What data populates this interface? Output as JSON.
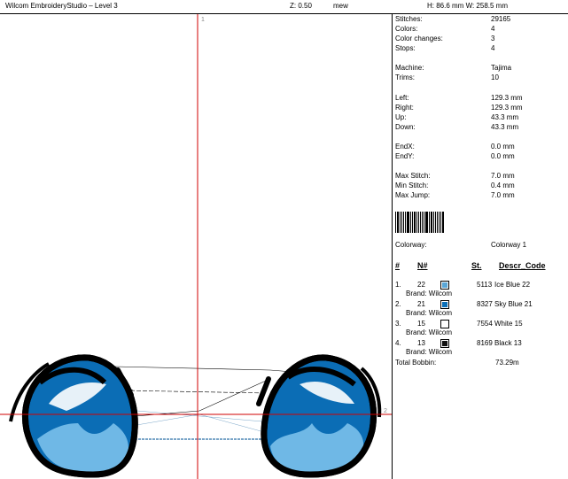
{
  "header": {
    "app_title": "Wilcom EmbroideryStudio – Level 3",
    "zoom": "Z: 0.50",
    "design_name": "mew",
    "dimensions": "H: 86.6 mm  W: 258.5 mm"
  },
  "canvas": {
    "marker_top": "1",
    "marker_right": "2"
  },
  "stats": [
    {
      "key": "Stitches:",
      "value": "29165"
    },
    {
      "key": "Colors:",
      "value": "4"
    },
    {
      "key": "Color changes:",
      "value": "3"
    },
    {
      "key": "Stops:",
      "value": "4"
    },
    {
      "key": "Machine:",
      "value": "Tajima"
    },
    {
      "key": "Trims:",
      "value": "10"
    },
    {
      "key": "Left:",
      "value": "129.3 mm"
    },
    {
      "key": "Right:",
      "value": "129.3 mm"
    },
    {
      "key": "Up:",
      "value": "43.3 mm"
    },
    {
      "key": "Down:",
      "value": "43.3 mm"
    },
    {
      "key": "EndX:",
      "value": "0.0 mm"
    },
    {
      "key": "EndY:",
      "value": "0.0 mm"
    },
    {
      "key": "Max Stitch:",
      "value": "7.0 mm"
    },
    {
      "key": "Min Stitch:",
      "value": "0.4 mm"
    },
    {
      "key": "Max Jump:",
      "value": "7.0 mm"
    }
  ],
  "colorway": {
    "key": "Colorway:",
    "value": "Colorway 1"
  },
  "columns": {
    "num": "#",
    "n": "N#",
    "st": "St.",
    "descr": "Descr_Code"
  },
  "threads": [
    {
      "index": "1.",
      "n": "22",
      "color": "#5aa6d6",
      "st": "5113",
      "descr": "Ice Blue 22",
      "brand": "Brand: Wilcom"
    },
    {
      "index": "2.",
      "n": "21",
      "color": "#0a6fb8",
      "st": "8327",
      "descr": "Sky Blue 21",
      "brand": "Brand: Wilcom"
    },
    {
      "index": "3.",
      "n": "15",
      "color": "#ffffff",
      "st": "7554",
      "descr": "White 15",
      "brand": "Brand: Wilcom"
    },
    {
      "index": "4.",
      "n": "13",
      "color": "#111111",
      "st": "8169",
      "descr": "Black 13",
      "brand": "Brand: Wilcom"
    }
  ],
  "total_bobbin": {
    "key": "Total Bobbin:",
    "value": "73.29m"
  }
}
